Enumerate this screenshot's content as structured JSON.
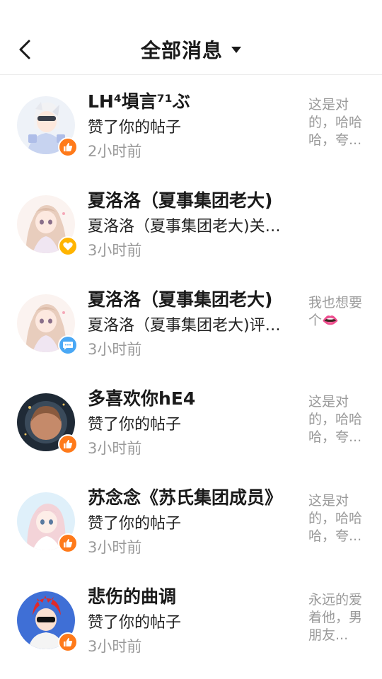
{
  "header": {
    "back_icon": "chevron-left-icon",
    "title": "全部消息",
    "dropdown_icon": "caret-down-icon"
  },
  "notifications": [
    {
      "name": "LH⁴塤言⁷¹ぶ",
      "action": "赞了你的帖子",
      "time": "2小时前",
      "preview": "这是对的，哈哈哈，夸...",
      "badge": "like"
    },
    {
      "name": "夏洛洛（夏事集团老大)",
      "action": "夏洛洛（夏事集团老大)关注了你",
      "time": "3小时前",
      "preview": "",
      "badge": "follow"
    },
    {
      "name": "夏洛洛（夏事集团老大)",
      "action": "夏洛洛（夏事集团老大)评论了你",
      "time": "3小时前",
      "preview": "我也想要个👄",
      "badge": "comment"
    },
    {
      "name": "多喜欢你hE4",
      "action": "赞了你的帖子",
      "time": "3小时前",
      "preview": "这是对的，哈哈哈，夸...",
      "badge": "like"
    },
    {
      "name": "苏念念《苏氏集团成员》",
      "action": "赞了你的帖子",
      "time": "3小时前",
      "preview": "这是对的，哈哈哈，夸...",
      "badge": "like"
    },
    {
      "name": "悲伤的曲调",
      "action": "赞了你的帖子",
      "time": "3小时前",
      "preview": "永远的爱着他，男朋友...",
      "badge": "like"
    }
  ],
  "colors": {
    "like_badge": "#ff7a1a",
    "follow_badge": "#ffb400",
    "comment_badge": "#4aa8f5",
    "secondary_text": "#9a9a9a"
  }
}
